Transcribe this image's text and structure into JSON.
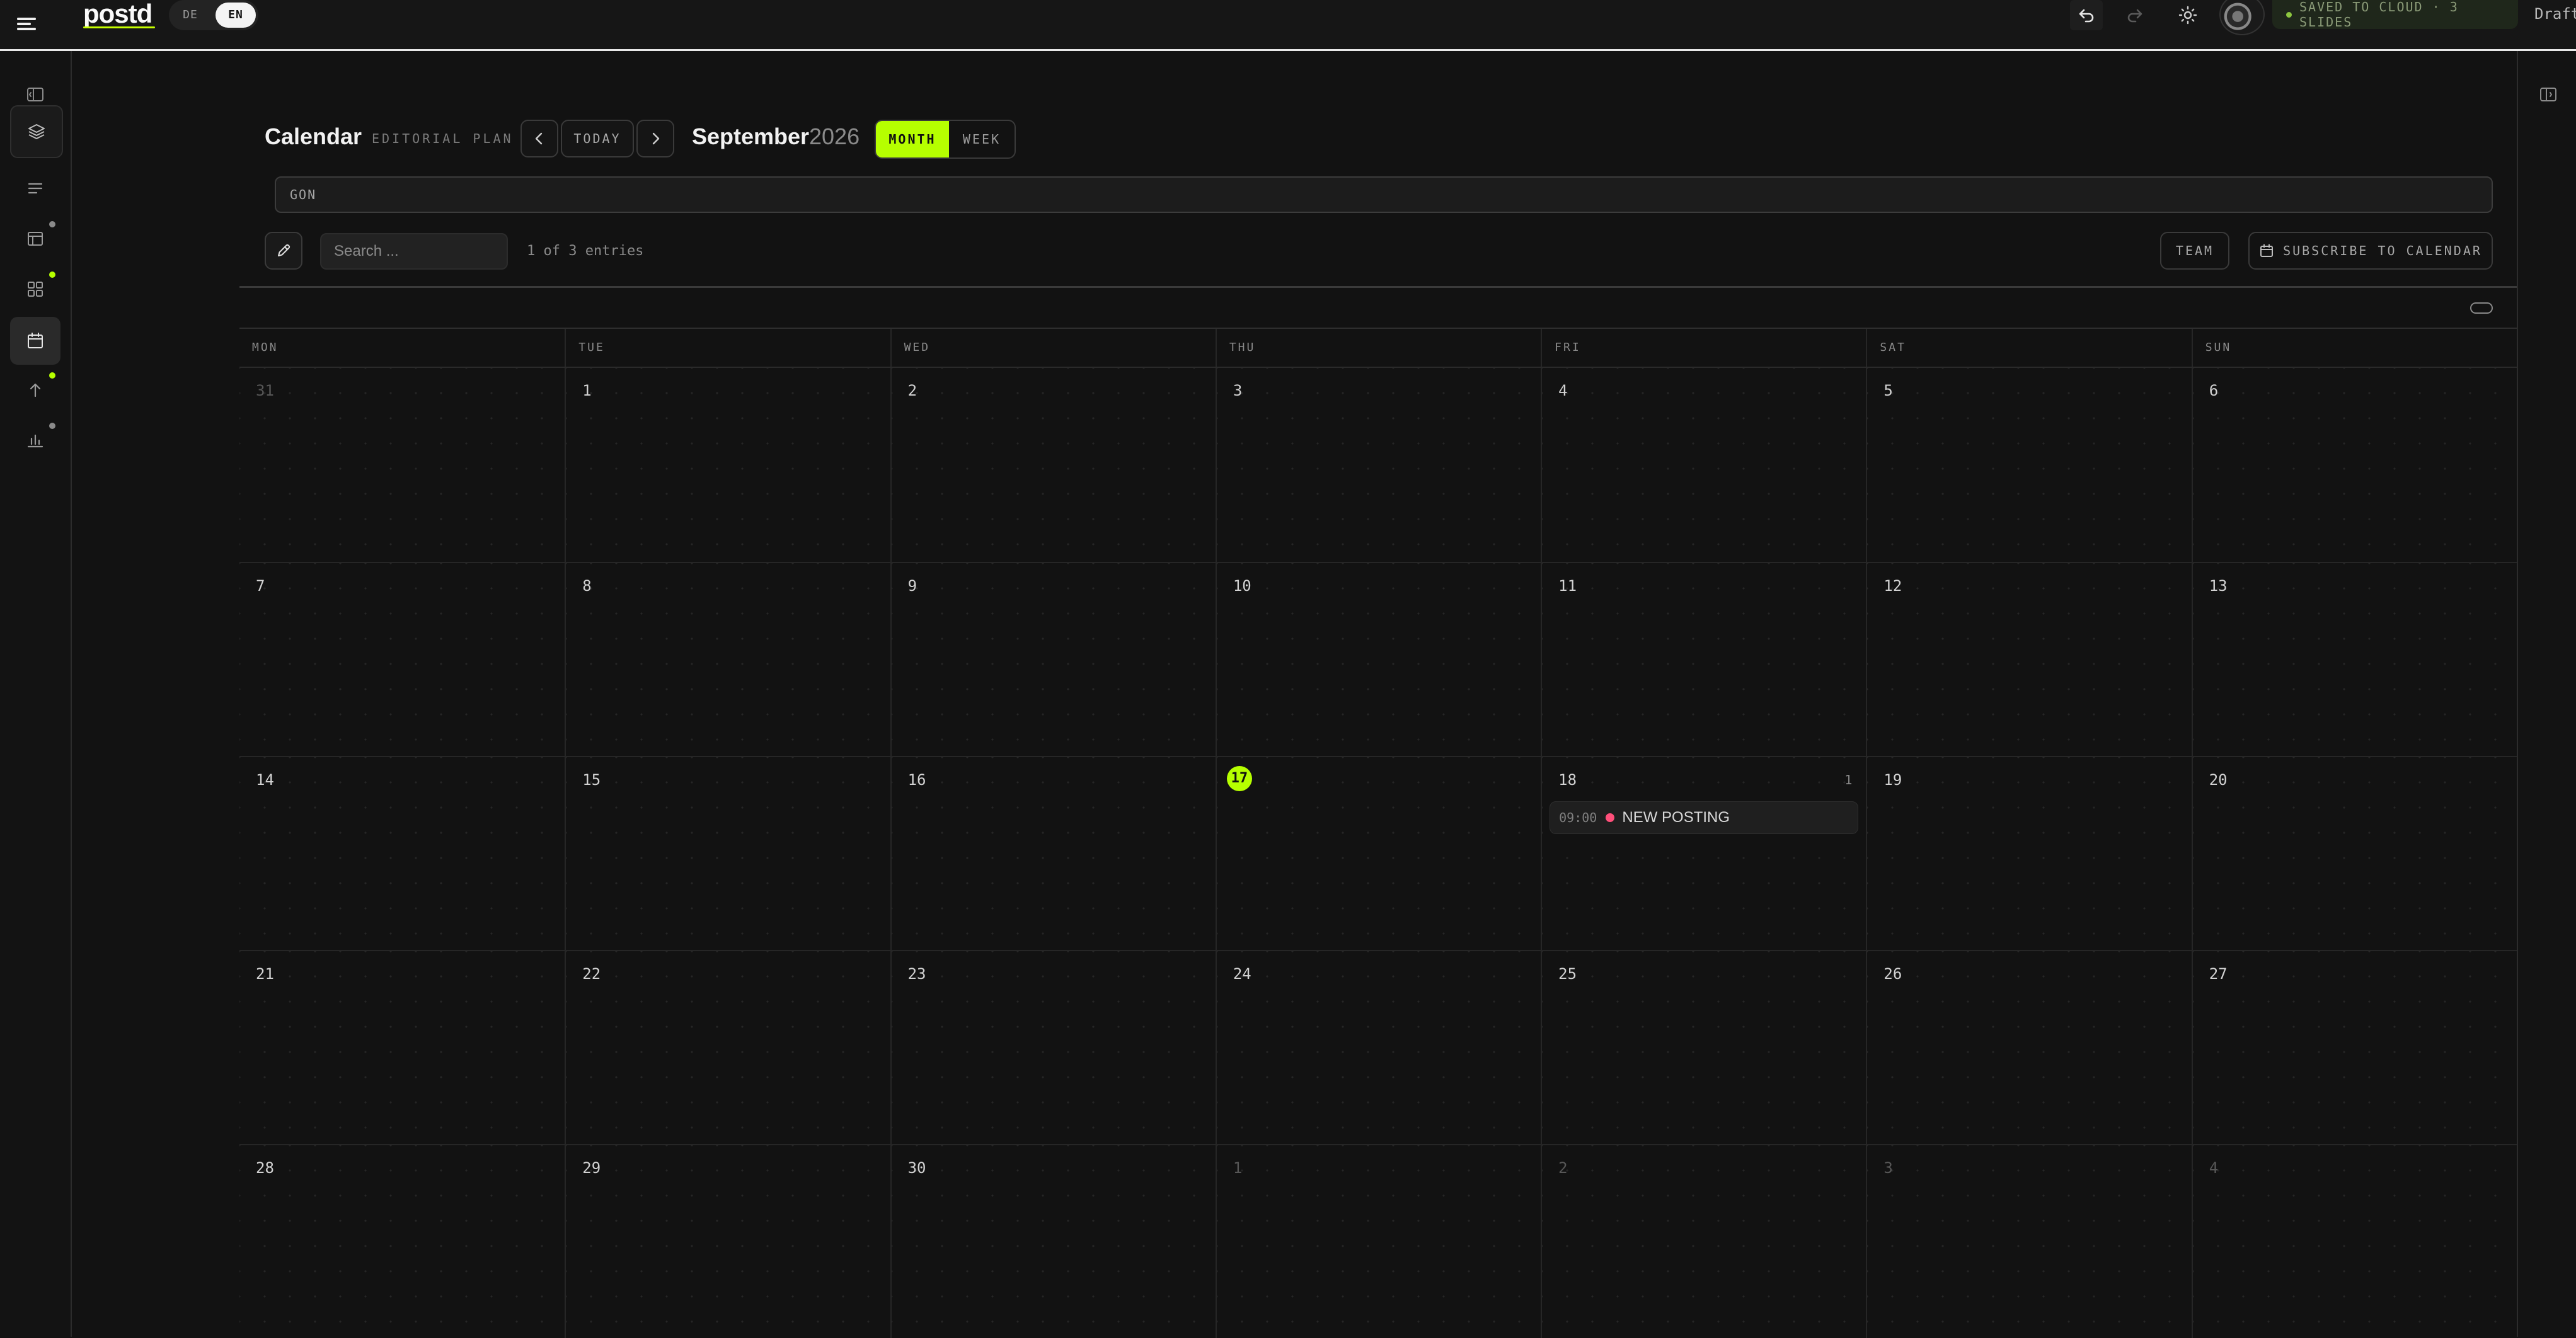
{
  "app": {
    "logo": "postd",
    "languages": {
      "de": "DE",
      "en": "EN",
      "active": "EN"
    },
    "status": "SAVED TO CLOUD · 3 SLIDES",
    "draft_label": "Draft",
    "accent_color": "#b6ff00",
    "icons": [
      "hamburger-icon",
      "undo-icon",
      "redo-icon",
      "sun-icon",
      "avatar"
    ]
  },
  "sidebar": {
    "items": [
      {
        "name": "panel-toggle",
        "icon": "sidebar-panel-icon"
      },
      {
        "name": "layers",
        "icon": "layers-icon"
      },
      {
        "name": "text",
        "icon": "lines-icon"
      },
      {
        "name": "table",
        "icon": "table-icon",
        "dot_color": "#8a8a8a"
      },
      {
        "name": "dashboard",
        "icon": "grid-icon",
        "dot_color": "#b6ff00"
      },
      {
        "name": "calendar",
        "icon": "calendar-icon",
        "active": true
      },
      {
        "name": "publish",
        "icon": "arrow-up-icon",
        "dot_color": "#b6ff00"
      },
      {
        "name": "analytics",
        "icon": "bar-chart-icon",
        "dot_color": "#8a8a8a"
      }
    ]
  },
  "header": {
    "title": "Calendar",
    "subtitle": "EDITORIAL PLAN",
    "today_label": "TODAY",
    "month": "September",
    "year": "2026",
    "views": {
      "month": "MONTH",
      "week": "WEEK",
      "active": "MONTH"
    }
  },
  "filter": {
    "value": "GON"
  },
  "toolbar": {
    "search_placeholder": "Search ...",
    "entries": "1 of 3 entries",
    "team_label": "TEAM",
    "subscribe_label": "SUBSCRIBE TO CALENDAR"
  },
  "calendar": {
    "weekdays": [
      "MON",
      "TUE",
      "WED",
      "THU",
      "FRI",
      "SAT",
      "SUN"
    ],
    "days": [
      {
        "d": "31",
        "muted": true
      },
      {
        "d": "1"
      },
      {
        "d": "2"
      },
      {
        "d": "3"
      },
      {
        "d": "4"
      },
      {
        "d": "5"
      },
      {
        "d": "6"
      },
      {
        "d": "7"
      },
      {
        "d": "8"
      },
      {
        "d": "9"
      },
      {
        "d": "10"
      },
      {
        "d": "11"
      },
      {
        "d": "12"
      },
      {
        "d": "13"
      },
      {
        "d": "14"
      },
      {
        "d": "15"
      },
      {
        "d": "16"
      },
      {
        "d": "17",
        "today": true
      },
      {
        "d": "18",
        "count": "1",
        "events": [
          {
            "time": "09:00",
            "title": "NEW POSTING",
            "color": "#ff4f7a"
          }
        ]
      },
      {
        "d": "19"
      },
      {
        "d": "20"
      },
      {
        "d": "21"
      },
      {
        "d": "22"
      },
      {
        "d": "23"
      },
      {
        "d": "24"
      },
      {
        "d": "25"
      },
      {
        "d": "26"
      },
      {
        "d": "27"
      },
      {
        "d": "28"
      },
      {
        "d": "29"
      },
      {
        "d": "30"
      },
      {
        "d": "1",
        "muted": true
      },
      {
        "d": "2",
        "muted": true
      },
      {
        "d": "3",
        "muted": true
      },
      {
        "d": "4",
        "muted": true
      }
    ]
  }
}
